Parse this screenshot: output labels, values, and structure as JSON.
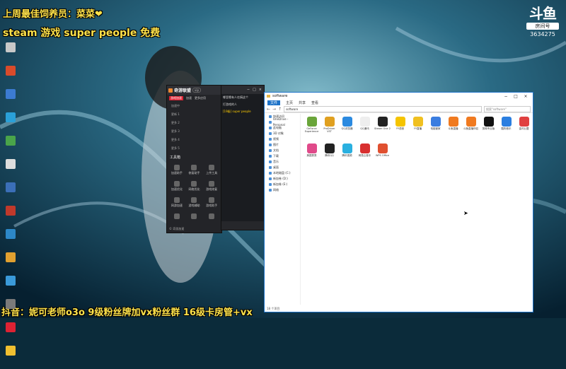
{
  "stream": {
    "top_line1": "上周最佳饲养员：菜菜❤",
    "top_line2": "steam 游戏 super people 免费",
    "bottom_ticker": "抖音：妮可老师o3o 9级粉丝牌加vx粉丝群  16级卡房管+vx",
    "platform_logo": "斗鱼",
    "room_label": "房间号",
    "room_number": "3634275"
  },
  "desktop_icons": [
    {
      "label": "",
      "color": "#c8c8c8"
    },
    {
      "label": "",
      "color": "#d94b2b"
    },
    {
      "label": "",
      "color": "#3c7bd1"
    },
    {
      "label": "",
      "color": "#2aa0d8"
    },
    {
      "label": "",
      "color": "#4aa44a"
    },
    {
      "label": "",
      "color": "#dddddd"
    },
    {
      "label": "",
      "color": "#3b6fb8"
    },
    {
      "label": "",
      "color": "#c0392b"
    },
    {
      "label": "",
      "color": "#2d88c8"
    },
    {
      "label": "",
      "color": "#e0a030"
    },
    {
      "label": "",
      "color": "#3a9ad9"
    },
    {
      "label": "",
      "color": "#7a7a7a"
    },
    {
      "label": "",
      "color": "#d23"
    },
    {
      "label": "",
      "color": "#f0c030"
    }
  ],
  "app": {
    "brand": "奇游联盟",
    "version": "vip",
    "nav": [
      "游戏加速",
      "加速",
      "更多应用"
    ],
    "items": [
      "加速中",
      "更新 1",
      "更多 2",
      "更多 3",
      "更多 4",
      "更多 5"
    ],
    "section": "工具箱",
    "tools": [
      "加速助手",
      "修复助手",
      "上传工具",
      "加速优化",
      "网络优化",
      "游戏修复",
      "网游加速",
      "游戏辅助",
      "游戏助手",
      "",
      "",
      ""
    ],
    "footer": "© 奇游加速"
  },
  "mid_panel": {
    "controls": [
      "−",
      "□",
      "×"
    ],
    "lines": [
      "哪里哦有人在搞这个",
      "打游戏的人"
    ],
    "highlight": "[19级]  super people",
    "bottom": ""
  },
  "explorer": {
    "title": "software",
    "tabs": [
      "文件",
      "主页",
      "共享",
      "查看"
    ],
    "path": "software",
    "search": "搜索\"software\"",
    "sidebar": [
      "快速访问",
      "OneDrive - Personal",
      "此电脑",
      "3D 对象",
      "视频",
      "图片",
      "文档",
      "下载",
      "音乐",
      "桌面",
      "本地磁盘 (C:)",
      "新加卷 (D:)",
      "新加卷 (E:)",
      "网络"
    ],
    "files": [
      {
        "name": "GeForce Experience",
        "color": "#6aa53a"
      },
      {
        "name": "ProDriver VST",
        "color": "#e0a020"
      },
      {
        "name": "QQ浏览器",
        "color": "#2b8ae0"
      },
      {
        "name": "QQ通讯",
        "color": "#eeeeee"
      },
      {
        "name": "Steam One 2",
        "color": "#222222"
      },
      {
        "name": "YY语音",
        "color": "#f5c400"
      },
      {
        "name": "YY直播",
        "color": "#f0c020"
      },
      {
        "name": "电脑管家",
        "color": "#3a7de0"
      },
      {
        "name": "斗鱼直播",
        "color": "#f07a20"
      },
      {
        "name": "斗鱼直播伴侣",
        "color": "#f07a20"
      },
      {
        "name": "剪映专业版",
        "color": "#111111"
      },
      {
        "name": "酷狗音乐",
        "color": "#2a7ee0"
      },
      {
        "name": "金闪公盟",
        "color": "#e04040"
      },
      {
        "name": "美图秀秀",
        "color": "#e04a8a"
      },
      {
        "name": "腾讯QQ",
        "color": "#222222"
      },
      {
        "name": "腾讯视频",
        "color": "#2ab0e0"
      },
      {
        "name": "网易云音乐",
        "color": "#d83030"
      },
      {
        "name": "WPS Office",
        "color": "#e05030"
      }
    ],
    "status": "18 个项目"
  }
}
